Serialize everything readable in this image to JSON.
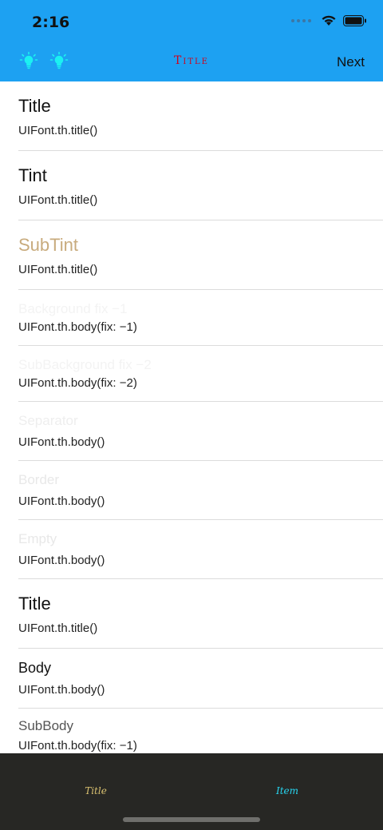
{
  "status": {
    "time": "2:16",
    "icons": [
      "signal-dots-icon",
      "wifi-icon",
      "battery-icon"
    ]
  },
  "navbar": {
    "left_icons": [
      "lightbulb-icon",
      "lightbulb-icon"
    ],
    "title": "Title",
    "right_button": "Next",
    "title_color": "#d0021b",
    "background": "#1da1f2"
  },
  "rows": [
    {
      "label": "Title",
      "sub": "UIFont.th.title()",
      "color": "#111111"
    },
    {
      "label": "Tint",
      "sub": "UIFont.th.title()",
      "color": "#111111"
    },
    {
      "label": "SubTint",
      "sub": "UIFont.th.title()",
      "color": "#c8ab7d"
    },
    {
      "label": "Background fix −1",
      "sub": "UIFont.th.body(fix: −1)",
      "color": "#f3f3f3"
    },
    {
      "label": "SubBackground fix −2",
      "sub": "UIFont.th.body(fix: −2)",
      "color": "#f3f3f3"
    },
    {
      "label": "Separator",
      "sub": "UIFont.th.body()",
      "color": "#eeeeee"
    },
    {
      "label": "Border",
      "sub": "UIFont.th.body()",
      "color": "#e8e8e8"
    },
    {
      "label": "Empty",
      "sub": "UIFont.th.body()",
      "color": "#e8e8e8"
    },
    {
      "label": "Title",
      "sub": "UIFont.th.title()",
      "color": "#111111"
    },
    {
      "label": "Body",
      "sub": "UIFont.th.body()",
      "color": "#111111"
    },
    {
      "label": "SubBody",
      "sub": "UIFont.th.body(fix: −1)",
      "color": "#555555"
    }
  ],
  "tabbar": {
    "tabs": [
      {
        "label": "Title",
        "color": "#d8c070"
      },
      {
        "label": "Item",
        "color": "#27d5f0"
      }
    ],
    "background": "#272724"
  }
}
